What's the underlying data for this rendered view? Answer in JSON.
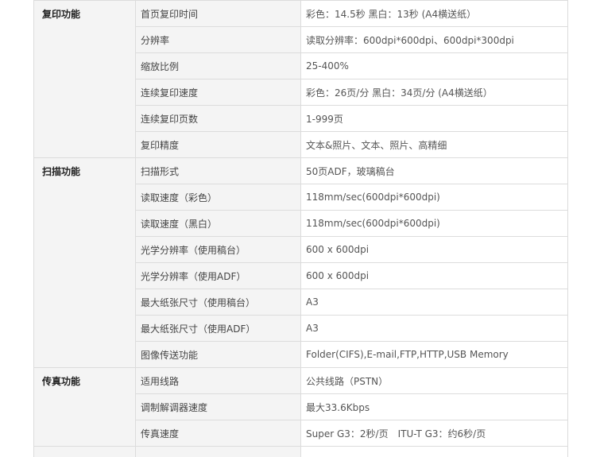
{
  "sections": [
    {
      "category": "复印功能",
      "rows": [
        {
          "label": "首页复印时间",
          "value": "彩色：14.5秒 黑白：13秒 (A4横送纸）"
        },
        {
          "label": "分辨率",
          "value": "读取分辨率：600dpi*600dpi、600dpi*300dpi"
        },
        {
          "label": "缩放比例",
          "value": "25-400%"
        },
        {
          "label": "连续复印速度",
          "value": "彩色：26页/分 黑白：34页/分 (A4横送纸）"
        },
        {
          "label": "连续复印页数",
          "value": "1-999页"
        },
        {
          "label": "复印精度",
          "value": "文本&照片、文本、照片、高精细"
        }
      ]
    },
    {
      "category": "扫描功能",
      "rows": [
        {
          "label": "扫描形式",
          "value": "50页ADF，玻璃稿台"
        },
        {
          "label": "读取速度（彩色）",
          "value": "118mm/sec(600dpi*600dpi)"
        },
        {
          "label": "读取速度（黑白）",
          "value": "118mm/sec(600dpi*600dpi)"
        },
        {
          "label": "光学分辨率（使用稿台）",
          "value": "600 x 600dpi"
        },
        {
          "label": "光学分辨率（使用ADF）",
          "value": "600 x 600dpi"
        },
        {
          "label": "最大纸张尺寸（使用稿台）",
          "value": "A3"
        },
        {
          "label": "最大纸张尺寸（使用ADF）",
          "value": "A3"
        },
        {
          "label": "图像传送功能",
          "value": "Folder(CIFS),E-mail,FTP,HTTP,USB Memory"
        }
      ]
    },
    {
      "category": "传真功能",
      "rows": [
        {
          "label": "适用线路",
          "value": "公共线路（PSTN）"
        },
        {
          "label": "调制解调器速度",
          "value": "最大33.6Kbps"
        },
        {
          "label": "传真速度",
          "value": "Super G3：2秒/页　ITU-T G3：约6秒/页"
        }
      ]
    }
  ]
}
